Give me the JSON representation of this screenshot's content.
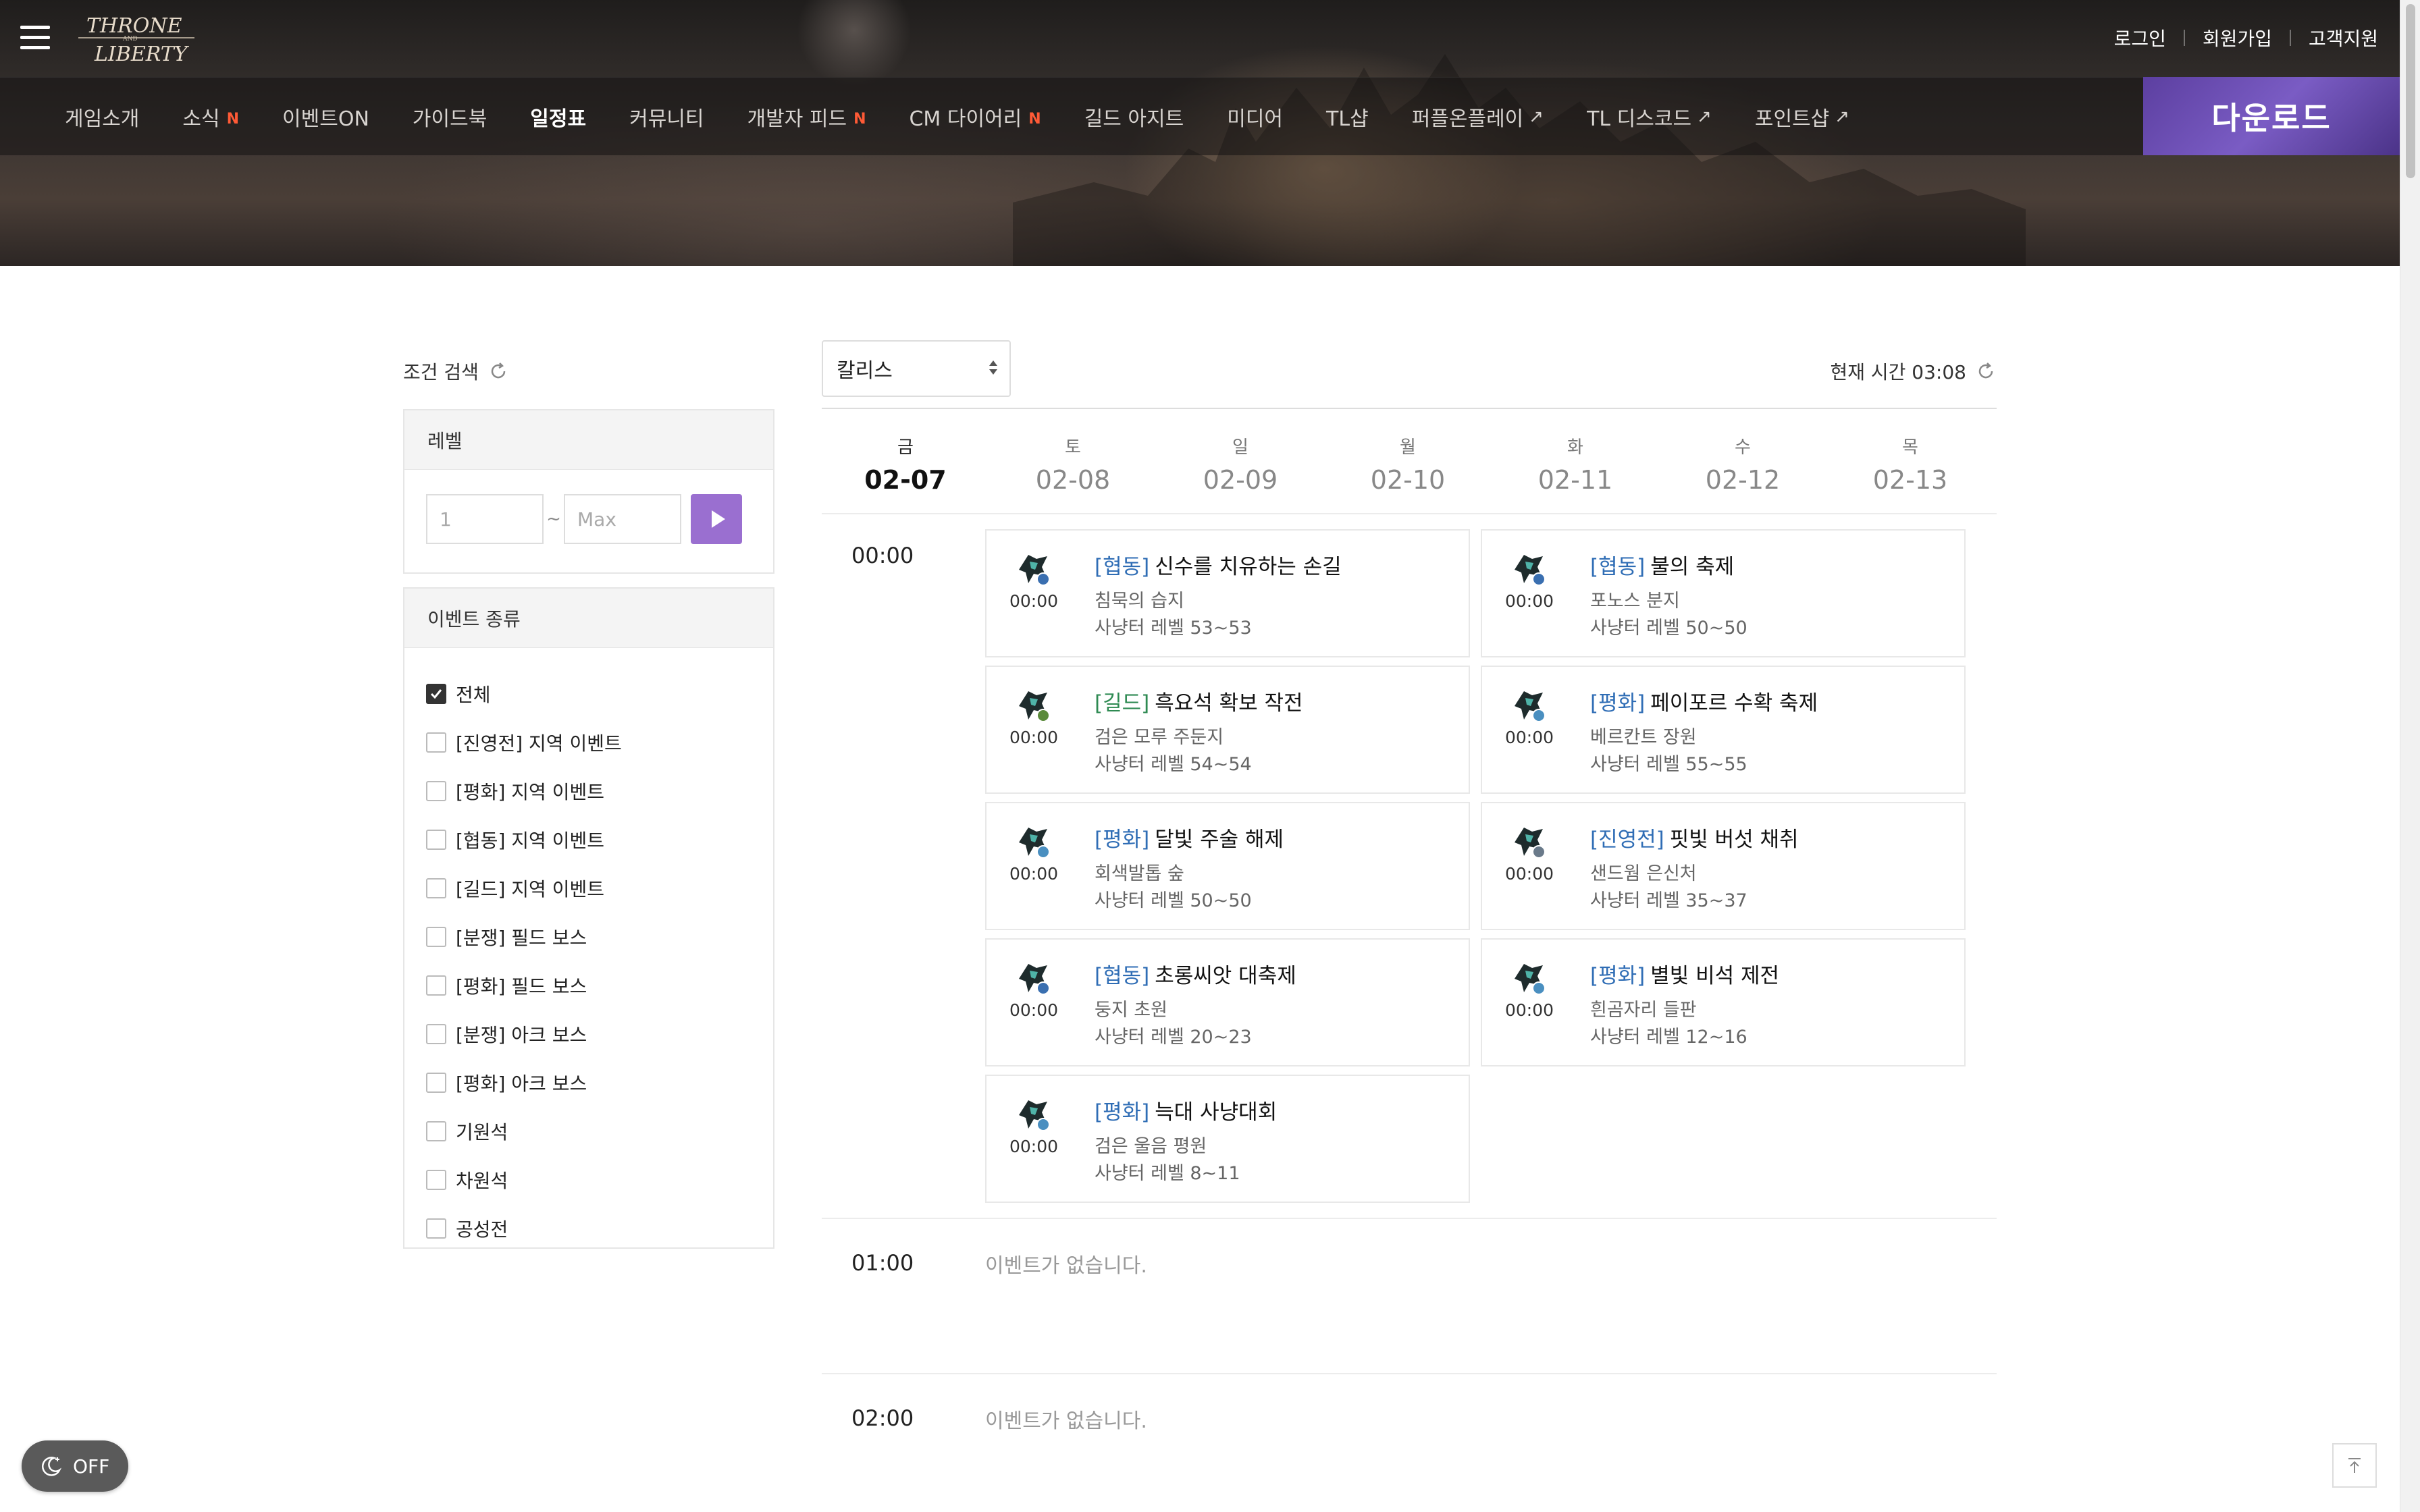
{
  "header": {
    "logo_text": "THRONE AND LIBERTY",
    "top_links": [
      "로그인",
      "회원가입",
      "고객지원"
    ],
    "download_label": "다운로드"
  },
  "gnb": [
    {
      "label": "게임소개",
      "new": "",
      "ext": ""
    },
    {
      "label": "소식",
      "new": "N",
      "ext": ""
    },
    {
      "label": "이벤트ON",
      "new": "",
      "ext": ""
    },
    {
      "label": "가이드북",
      "new": "",
      "ext": ""
    },
    {
      "label": "일정표",
      "new": "",
      "ext": "",
      "active": true
    },
    {
      "label": "커뮤니티",
      "new": "",
      "ext": ""
    },
    {
      "label": "개발자 피드",
      "new": "N",
      "ext": ""
    },
    {
      "label": "CM 다이어리",
      "new": "N",
      "ext": ""
    },
    {
      "label": "길드 아지트",
      "new": "",
      "ext": ""
    },
    {
      "label": "미디어",
      "new": "",
      "ext": ""
    },
    {
      "label": "TL샵",
      "new": "",
      "ext": ""
    },
    {
      "label": "퍼플온플레이",
      "new": "",
      "ext": "↗"
    },
    {
      "label": "TL 디스코드",
      "new": "",
      "ext": "↗"
    },
    {
      "label": "포인트샵",
      "new": "",
      "ext": "↗"
    }
  ],
  "filter": {
    "title": "조건 검색",
    "level_title": "레벨",
    "level_min_placeholder": "1",
    "level_sep": "~",
    "level_max_placeholder": "Max",
    "type_title": "이벤트 종류",
    "types": [
      {
        "label": "전체",
        "checked": true
      },
      {
        "label": "[진영전] 지역 이벤트",
        "checked": false
      },
      {
        "label": "[평화] 지역 이벤트",
        "checked": false
      },
      {
        "label": "[협동] 지역 이벤트",
        "checked": false
      },
      {
        "label": "[길드] 지역 이벤트",
        "checked": false
      },
      {
        "label": "[분쟁] 필드 보스",
        "checked": false
      },
      {
        "label": "[평화] 필드 보스",
        "checked": false
      },
      {
        "label": "[분쟁] 아크 보스",
        "checked": false
      },
      {
        "label": "[평화] 아크 보스",
        "checked": false
      },
      {
        "label": "기원석",
        "checked": false
      },
      {
        "label": "차원석",
        "checked": false
      },
      {
        "label": "공성전",
        "checked": false
      }
    ]
  },
  "schedule": {
    "server": "칼리스",
    "now_time": "현재 시간 03:08",
    "days": [
      {
        "dow": "금",
        "date": "02-07",
        "active": true
      },
      {
        "dow": "토",
        "date": "02-08",
        "active": false
      },
      {
        "dow": "일",
        "date": "02-09",
        "active": false
      },
      {
        "dow": "월",
        "date": "02-10",
        "active": false
      },
      {
        "dow": "화",
        "date": "02-11",
        "active": false
      },
      {
        "dow": "수",
        "date": "02-12",
        "active": false
      },
      {
        "dow": "목",
        "date": "02-13",
        "active": false
      }
    ],
    "hours": [
      {
        "hour": "00:00",
        "events": [
          {
            "tag": "[협동]",
            "tag_color": "#2f6db5",
            "name": "신수를 치유하는 손길",
            "location": "침묵의 습지",
            "level": "사냥터 레벨 53~53",
            "time": "00:00",
            "badge": "#3a6fb0"
          },
          {
            "tag": "[협동]",
            "tag_color": "#2f6db5",
            "name": "불의 축제",
            "location": "포노스 분지",
            "level": "사냥터 레벨 50~50",
            "time": "00:00",
            "badge": "#3a6fb0"
          },
          {
            "tag": "[길드]",
            "tag_color": "#2e8a52",
            "name": "흑요석 확보 작전",
            "location": "검은 모루 주둔지",
            "level": "사냥터 레벨 54~54",
            "time": "00:00",
            "badge": "#5a8a3a"
          },
          {
            "tag": "[평화]",
            "tag_color": "#2f6db5",
            "name": "페이포르 수확 축제",
            "location": "베르칸트 장원",
            "level": "사냥터 레벨 55~55",
            "time": "00:00",
            "badge": "#4a8fc0"
          },
          {
            "tag": "[평화]",
            "tag_color": "#2f6db5",
            "name": "달빛 주술 해제",
            "location": "회색발톱 숲",
            "level": "사냥터 레벨 50~50",
            "time": "00:00",
            "badge": "#4a8fc0"
          },
          {
            "tag": "[진영전]",
            "tag_color": "#2f6db5",
            "name": "핏빛 버섯 채취",
            "location": "샌드웜 은신처",
            "level": "사냥터 레벨 35~37",
            "time": "00:00",
            "badge": "#6a7a8a"
          },
          {
            "tag": "[협동]",
            "tag_color": "#2f6db5",
            "name": "초롱씨앗 대축제",
            "location": "둥지 초원",
            "level": "사냥터 레벨 20~23",
            "time": "00:00",
            "badge": "#3a6fb0"
          },
          {
            "tag": "[평화]",
            "tag_color": "#2f6db5",
            "name": "별빛 비석 제전",
            "location": "흰곰자리 들판",
            "level": "사냥터 레벨 12~16",
            "time": "00:00",
            "badge": "#4a8fc0"
          },
          {
            "tag": "[평화]",
            "tag_color": "#2f6db5",
            "name": "늑대 사냥대회",
            "location": "검은 울음 평원",
            "level": "사냥터 레벨 8~11",
            "time": "00:00",
            "badge": "#4a8fc0"
          }
        ]
      },
      {
        "hour": "01:00",
        "empty_text": "이벤트가 없습니다."
      },
      {
        "hour": "02:00",
        "empty_text": "이벤트가 없습니다."
      }
    ]
  },
  "floating": {
    "dark_mode_label": "OFF"
  },
  "colors": {
    "accent_purple": "#9a6fd0",
    "new_badge": "#ff5a36",
    "tag_blue": "#2f6db5",
    "tag_green": "#2e8a52"
  }
}
